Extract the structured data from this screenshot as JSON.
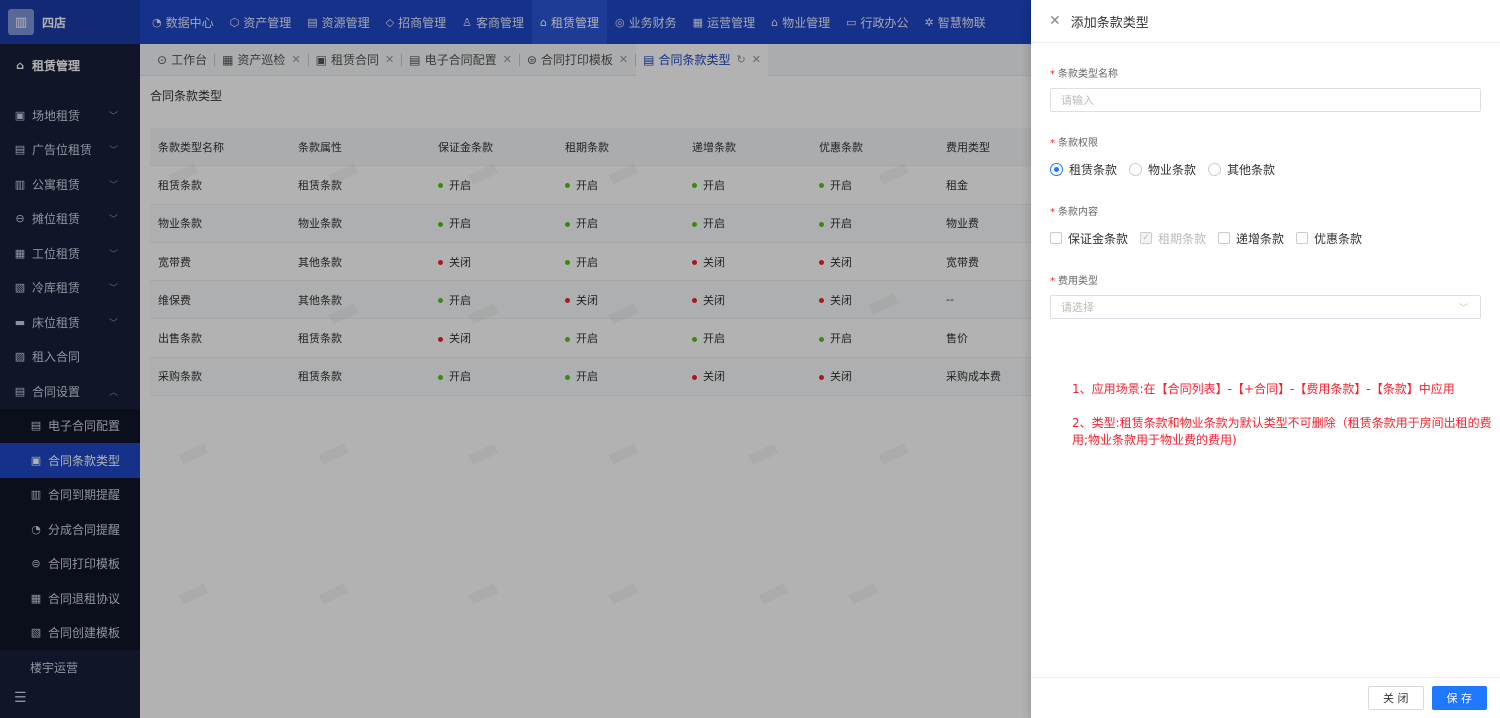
{
  "brand": {
    "logo_label": "四店"
  },
  "topnav": [
    {
      "icon": "◔",
      "label": "数据中心"
    },
    {
      "icon": "⬡",
      "label": "资产管理"
    },
    {
      "icon": "▤",
      "label": "资源管理"
    },
    {
      "icon": "◇",
      "label": "招商管理"
    },
    {
      "icon": "♙",
      "label": "客商管理"
    },
    {
      "icon": "⌂",
      "label": "租赁管理",
      "active": true
    },
    {
      "icon": "◎",
      "label": "业务财务"
    },
    {
      "icon": "▦",
      "label": "运营管理"
    },
    {
      "icon": "⌂",
      "label": "物业管理"
    },
    {
      "icon": "▭",
      "label": "行政办公"
    },
    {
      "icon": "✲",
      "label": "智慧物联"
    }
  ],
  "sidebar": {
    "header": "租赁管理",
    "items": [
      "场地租赁",
      "广告位租赁",
      "公寓租赁",
      "摊位租赁",
      "工位租赁",
      "冷库租赁",
      "床位租赁",
      "租入合同",
      "合同设置"
    ],
    "sub_items": [
      "电子合同配置",
      "合同条款类型",
      "合同到期提醒",
      "分成合同提醒",
      "合同打印模板",
      "合同退租协议",
      "合同创建模板"
    ],
    "extra": "楼宇运营"
  },
  "tabs": [
    {
      "label": "工作台"
    },
    {
      "label": "资产巡检"
    },
    {
      "label": "租赁合同"
    },
    {
      "label": "电子合同配置"
    },
    {
      "label": "合同打印模板"
    },
    {
      "label": "合同条款类型"
    }
  ],
  "page_title": "合同条款类型",
  "table": {
    "columns": [
      "条款类型名称",
      "条款属性",
      "保证金条款",
      "租期条款",
      "递增条款",
      "优惠条款",
      "费用类型"
    ],
    "rows": [
      [
        "租赁条款",
        "租赁条款",
        "开启",
        "开启",
        "开启",
        "开启",
        "租金"
      ],
      [
        "物业条款",
        "物业条款",
        "开启",
        "开启",
        "开启",
        "开启",
        "物业费"
      ],
      [
        "宽带费",
        "其他条款",
        "关闭",
        "开启",
        "关闭",
        "关闭",
        "宽带费"
      ],
      [
        "维保费",
        "其他条款",
        "开启",
        "关闭",
        "关闭",
        "关闭",
        "--"
      ],
      [
        "出售条款",
        "租赁条款",
        "关闭",
        "开启",
        "开启",
        "开启",
        "售价"
      ],
      [
        "采购条款",
        "租赁条款",
        "开启",
        "开启",
        "关闭",
        "关闭",
        "采购成本费"
      ]
    ]
  },
  "status_colors": {
    "on": "#52c41a",
    "off": "#f5222d"
  },
  "drawer": {
    "title": "添加条款类型",
    "name_label": "条款类型名称",
    "name_placeholder": "请输入",
    "permission_label": "条款权限",
    "permission_options": [
      "租赁条款",
      "物业条款",
      "其他条款"
    ],
    "content_label": "条款内容",
    "content_options": [
      "保证金条款",
      "租期条款",
      "递增条款",
      "优惠条款"
    ],
    "fee_label": "费用类型",
    "fee_placeholder": "请选择",
    "note1": "1、应用场景:在【合同列表】-【+合同】-【费用条款】-【条款】中应用",
    "note2": "2、类型:租赁条款和物业条款为默认类型不可删除（租赁条款用于房间出租的费用;物业条款用于物业费的费用)",
    "close_btn": "关 闭",
    "save_btn": "保 存"
  }
}
